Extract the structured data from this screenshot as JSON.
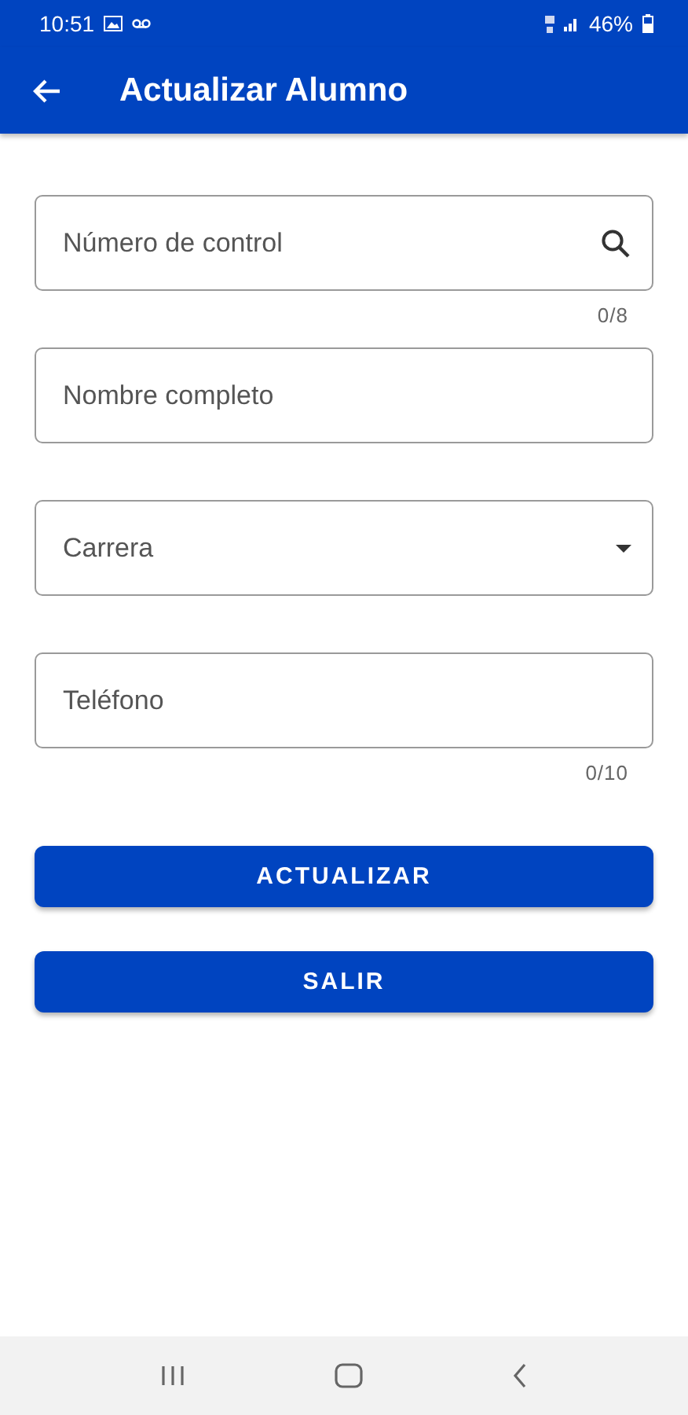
{
  "status_bar": {
    "time": "10:51",
    "battery": "46%"
  },
  "app_bar": {
    "title": "Actualizar Alumno"
  },
  "fields": [
    {
      "kind": "search",
      "placeholder": "Número de control",
      "counter": "0/8"
    },
    {
      "kind": "text",
      "placeholder": "Nombre completo"
    },
    {
      "kind": "dropdown",
      "placeholder": "Carrera"
    },
    {
      "kind": "text",
      "placeholder": "Teléfono",
      "counter": "0/10"
    }
  ],
  "buttons": [
    "ACTUALIZAR",
    "SALIR"
  ]
}
